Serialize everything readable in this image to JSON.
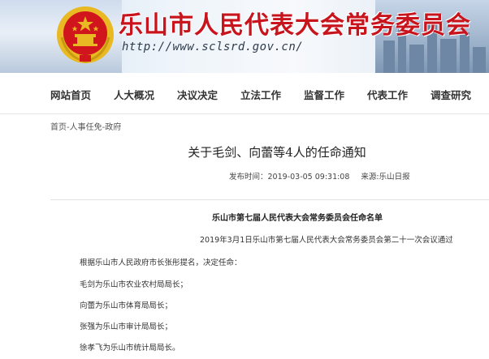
{
  "banner": {
    "title": "乐山市人民代表大会常务委员会",
    "url": "http://www.sclsrd.gov.cn/",
    "colors": {
      "title": "#c8141c",
      "emblem_red": "#d0151d",
      "emblem_gold": "#e8b923"
    }
  },
  "nav": {
    "items": [
      {
        "label": "网站首页"
      },
      {
        "label": "人大概况"
      },
      {
        "label": "决议决定"
      },
      {
        "label": "立法工作"
      },
      {
        "label": "监督工作"
      },
      {
        "label": "代表工作"
      },
      {
        "label": "调查研究"
      }
    ]
  },
  "breadcrumb": "首页-人事任免-政府",
  "article": {
    "title": "关于毛剑、向蕾等4人的任命通知",
    "publish_time": "发布时间：2019-03-05 09:31:08",
    "source": "来源:乐山日报",
    "list_heading": "乐山市第七届人民代表大会常务委员会任命名单",
    "paragraphs": [
      "2019年3月1日乐山市第七届人民代表大会常务委员会第二十一次会议通过",
      "根据乐山市人民政府市长张彤提名，决定任命：",
      "毛剑为乐山市农业农村局局长；",
      "向蕾为乐山市体育局局长；",
      "张强为乐山市审计局局长；",
      "徐孝飞为乐山市统计局局长。"
    ]
  }
}
